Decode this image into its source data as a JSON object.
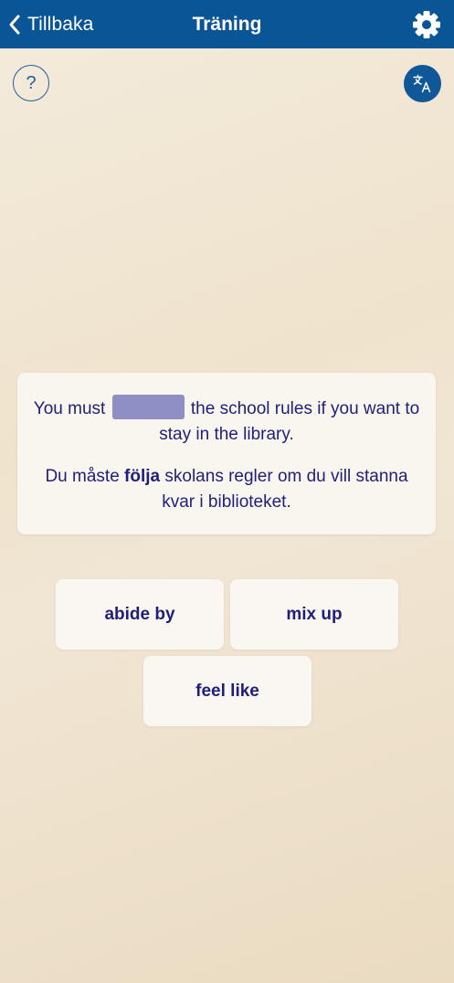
{
  "header": {
    "back_label": "Tillbaka",
    "title": "Träning",
    "settings_icon": "gear-icon",
    "background": "#0a5596"
  },
  "help": {
    "label": "?"
  },
  "translate": {
    "icon": "translate-icon"
  },
  "exercise": {
    "sentence_en_before": "You must",
    "sentence_en_after": "the school rules if you want to stay in the library.",
    "sentence_sv_before": "Du måste",
    "sentence_sv_highlight": "följa",
    "sentence_sv_after": "skolans regler om du vill stanna kvar i biblioteket.",
    "blank_color": "#8f8fc6",
    "text_color": "#1f1f7a"
  },
  "choices": [
    {
      "label": "abide by"
    },
    {
      "label": "mix up"
    },
    {
      "label": "feel like"
    }
  ]
}
